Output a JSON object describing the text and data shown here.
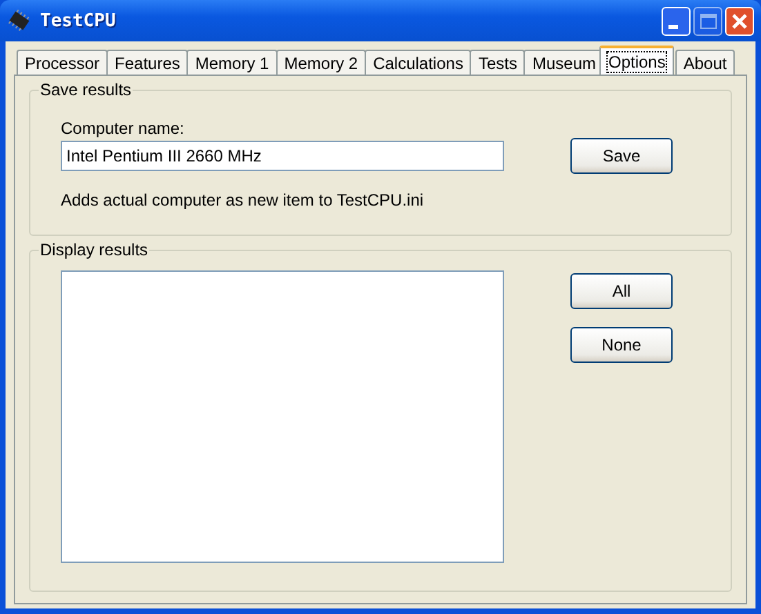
{
  "window": {
    "title": "TestCPU"
  },
  "title_buttons": [
    {
      "kind": "minimize",
      "disabled": false
    },
    {
      "kind": "maximize",
      "disabled": true
    },
    {
      "kind": "close",
      "disabled": false
    }
  ],
  "tabs": [
    {
      "label": "Processor",
      "selected": false
    },
    {
      "label": "Features",
      "selected": false
    },
    {
      "label": "Memory 1",
      "selected": false
    },
    {
      "label": "Memory 2",
      "selected": false
    },
    {
      "label": "Calculations",
      "selected": false
    },
    {
      "label": "Tests",
      "selected": false
    },
    {
      "label": "Museum",
      "selected": false
    },
    {
      "label": "Options",
      "selected": true
    },
    {
      "label": "About",
      "selected": false
    }
  ],
  "save_results": {
    "title": "Save results",
    "label": "Computer name:",
    "value": "Intel Pentium III 2660 MHz",
    "button": "Save",
    "note": "Adds actual computer as new item to TestCPU.ini"
  },
  "display_results": {
    "title": "Display results",
    "buttons": [
      "All",
      "None"
    ]
  }
}
